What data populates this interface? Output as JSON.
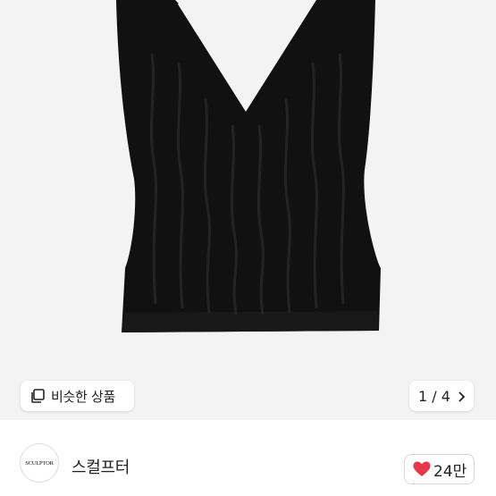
{
  "product": {
    "similar_label": "비슷한 상품",
    "pager_text": "1 / 4"
  },
  "shop": {
    "logo_text": "SCULPTOR",
    "name": "스컬프터",
    "like_count": "24만"
  },
  "colors": {
    "heart": "#e8364a",
    "garment": "#111111",
    "image_bg": "#f3f3f3"
  },
  "icons": [
    "copy-icon",
    "chevron-right-icon",
    "heart-icon"
  ]
}
